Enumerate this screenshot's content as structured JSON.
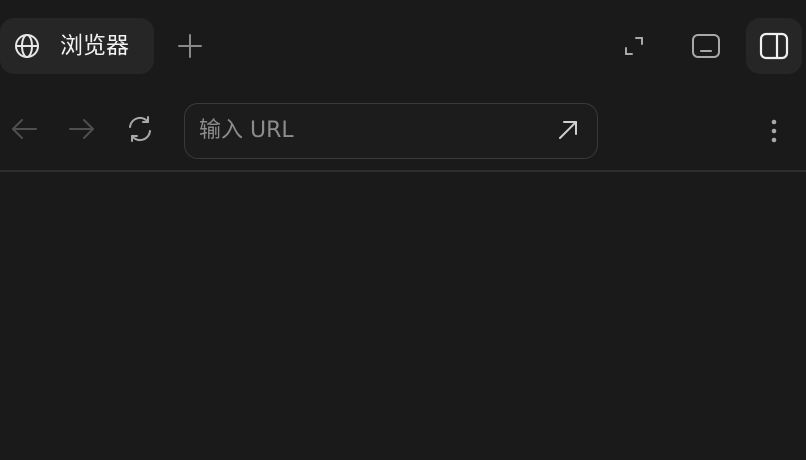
{
  "tab": {
    "title": "浏览器",
    "icon": "globe-icon"
  },
  "tab_actions": {
    "new_tab_icon": "plus-icon"
  },
  "window_controls": {
    "expand_icon": "expand-icon",
    "bottom_panel_icon": "bottom-panel-icon",
    "side_panel_icon": "side-panel-icon"
  },
  "toolbar": {
    "back_icon": "arrow-left-icon",
    "forward_icon": "arrow-right-icon",
    "reload_icon": "reload-icon",
    "url_placeholder": "输入 URL",
    "url_value": "",
    "go_icon": "arrow-up-right-icon",
    "menu_icon": "more-vertical-icon"
  },
  "colors": {
    "background": "#1a1a1a",
    "tab_background": "#262626",
    "icon_muted": "#5a5a5a",
    "icon_normal": "#a8a8a8",
    "text": "#f2f2f2",
    "placeholder": "#8c8c8c"
  }
}
